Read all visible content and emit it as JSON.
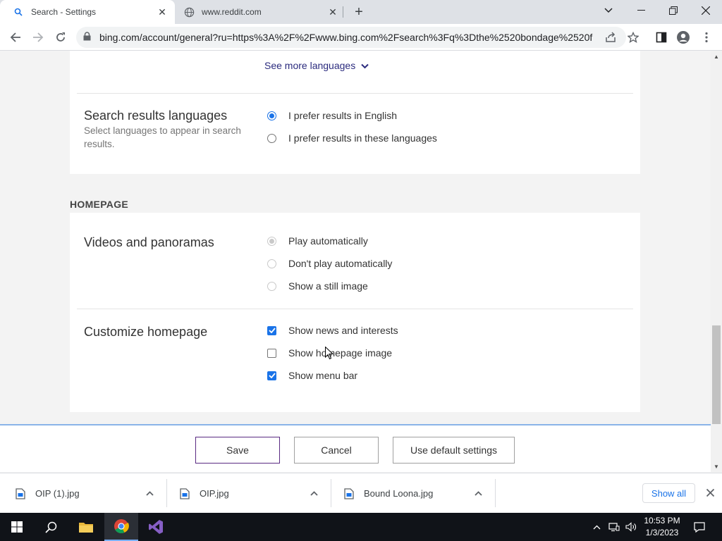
{
  "browser": {
    "tabs": [
      {
        "title": "Search - Settings",
        "active": true
      },
      {
        "title": "www.reddit.com",
        "active": false
      }
    ],
    "url": "bing.com/account/general?ru=https%3A%2F%2Fwww.bing.com%2Fsearch%3Fq%3Dthe%2520bondage%2520fu..."
  },
  "settings": {
    "see_more_languages": "See more languages",
    "search_results_languages": {
      "title": "Search results languages",
      "description": "Select languages to appear in search results.",
      "options": [
        "I prefer results in English",
        "I prefer results in these languages"
      ],
      "selected": 0
    },
    "homepage_heading": "HOMEPAGE",
    "videos": {
      "title": "Videos and panoramas",
      "options": [
        "Play automatically",
        "Don't play automatically",
        "Show a still image"
      ],
      "selected": 0,
      "disabled": true
    },
    "customize": {
      "title": "Customize homepage",
      "options": [
        {
          "label": "Show news and interests",
          "checked": true
        },
        {
          "label": "Show homepage image",
          "checked": false
        },
        {
          "label": "Show menu bar",
          "checked": true
        }
      ]
    }
  },
  "footer": {
    "save": "Save",
    "cancel": "Cancel",
    "default": "Use default settings"
  },
  "downloads": {
    "items": [
      "OIP (1).jpg",
      "OIP.jpg",
      "Bound Loona.jpg"
    ],
    "show_all": "Show all"
  },
  "taskbar": {
    "time": "10:53 PM",
    "date": "1/3/2023"
  },
  "colors": {
    "accent": "#1a73e8",
    "save_border": "#5a2a82",
    "link": "#2b2b7e"
  }
}
